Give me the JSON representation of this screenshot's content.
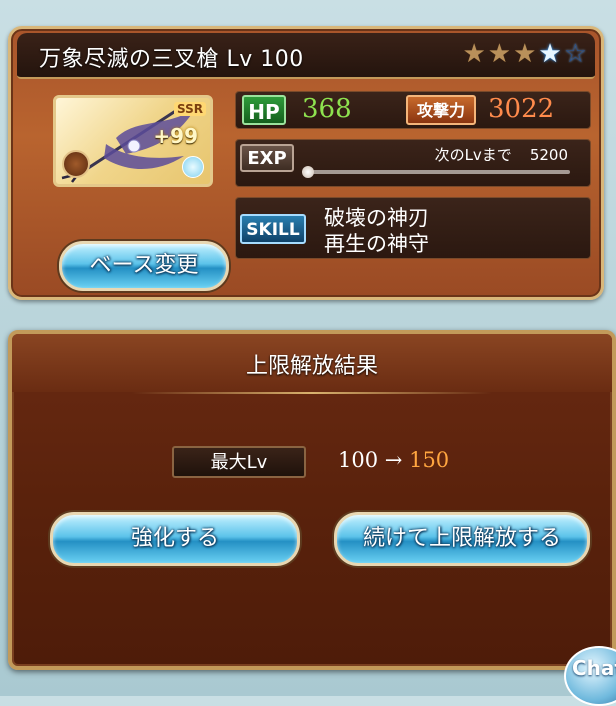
{
  "weapon": {
    "title": "万象尽滅の三叉槍 Lv 100",
    "rarity": "SSR",
    "plus": "+99",
    "stars": [
      "gold",
      "gold",
      "gold",
      "blue",
      "empty"
    ]
  },
  "stats": {
    "hp_label": "HP",
    "hp_value": "368",
    "atk_label": "攻撃力",
    "atk_value": "3022",
    "exp_label": "EXP",
    "exp_next_label": "次のLvまで",
    "exp_next_value": "5200",
    "exp_progress": 0,
    "skill_label": "SKILL",
    "skills": [
      "破壊の神刃",
      "再生の神守"
    ]
  },
  "buttons": {
    "base_change": "ベース変更",
    "enhance": "強化する",
    "continue_uncap": "続けて上限解放する"
  },
  "result": {
    "title": "上限解放結果",
    "max_lv_label": "最大Lv",
    "from": "100",
    "arrow": "→",
    "to": "150"
  },
  "chat": {
    "label": "Chat"
  },
  "colors": {
    "hp_value": "#8ee24f",
    "atk_value": "#ff8b4c",
    "lv_to": "#ffa640"
  }
}
